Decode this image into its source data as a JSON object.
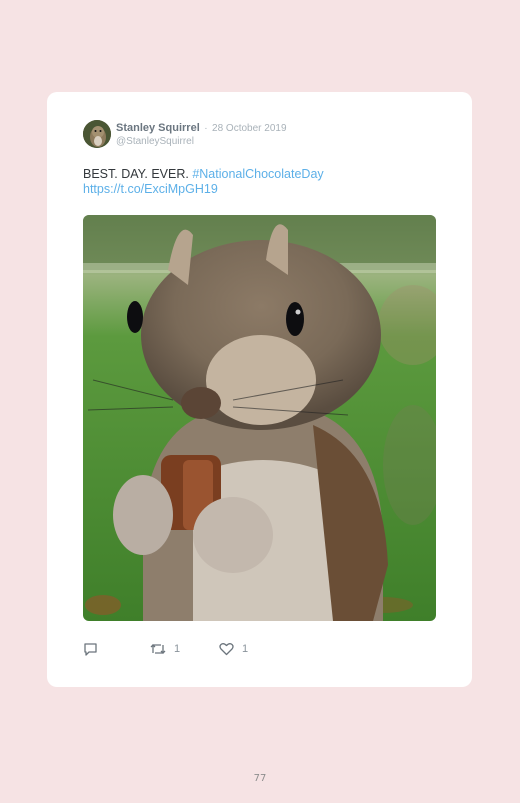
{
  "tweet": {
    "author_name": "Stanley Squirrel",
    "separator": "·",
    "date": "28 October 2019",
    "handle": "@StanleySquirrel",
    "text_plain": "BEST. DAY. EVER. ",
    "hashtag": "#NationalChocolateDay",
    "link": "https://t.co/ExciMpGH19",
    "image_description_icon": "squirrel-photo",
    "actions": {
      "reply_icon": "reply-icon",
      "retweet_icon": "retweet-icon",
      "retweet_count": "1",
      "like_icon": "heart-icon",
      "like_count": "1"
    }
  },
  "page": {
    "number": "77"
  },
  "colors": {
    "background": "#f6e3e4",
    "card": "#ffffff",
    "link": "#5db0e8",
    "meta": "#a9b2b9"
  }
}
